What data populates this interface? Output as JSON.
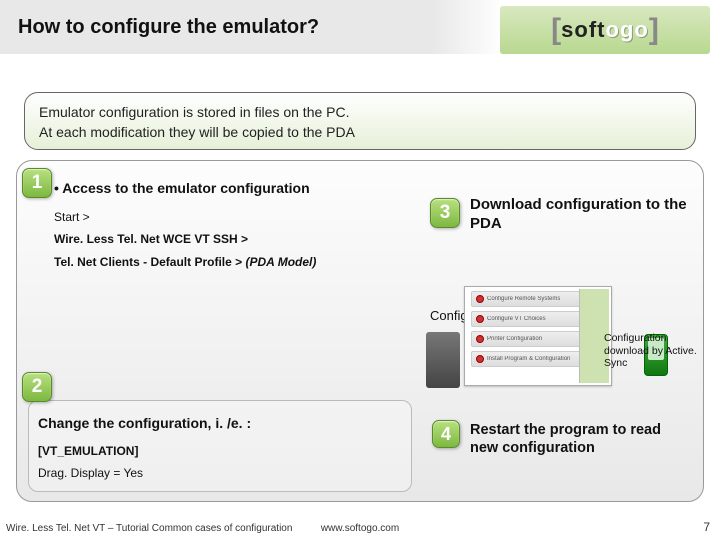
{
  "header": {
    "title": "How to configure the emulator?",
    "logo": {
      "left_bracket": "[",
      "soft": "soft",
      "togo": "ogo",
      "right_bracket": "]"
    }
  },
  "intro": {
    "line1": "Emulator configuration is stored in files on the PC.",
    "line2": "At each modification they will be copied to the PDA"
  },
  "steps": {
    "s1": {
      "num": "1",
      "title": "• Access to the emulator configuration",
      "line_a": "Start >",
      "line_b": "Wire. Less Tel. Net WCE VT SSH >",
      "line_c_prefix": "Tel. Net Clients - Default Profile > ",
      "line_c_model": "(PDA Model)"
    },
    "s2": {
      "num": "2",
      "title": "Change the configuration, i. /e. :",
      "line_a": "[VT_EMULATION]",
      "line_b": "Drag. Display = Yes"
    },
    "s3": {
      "num": "3",
      "text": "Download configuration to the PDA"
    },
    "s4": {
      "num": "4",
      "text": "Restart the program to read new configuration"
    }
  },
  "diagram": {
    "config_label": "Configuration",
    "activesync": "Configuration download by Active. Sync"
  },
  "footer": {
    "left": "Wire. Less Tel. Net VT – Tutorial Common cases of configuration",
    "center": "www.softogo.com",
    "page": "7"
  }
}
